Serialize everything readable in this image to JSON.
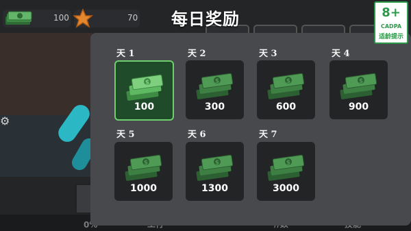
{
  "hud": {
    "cash": "100",
    "stars": "70"
  },
  "title": "每日奖励",
  "rating": {
    "age": "8+",
    "org": "CADPA",
    "label": "适龄提示"
  },
  "bottom_nav": [
    "0%",
    "工行",
    "//数",
    "技能"
  ],
  "days": [
    {
      "label": "天 1",
      "amount": "100",
      "claimed": true
    },
    {
      "label": "天 2",
      "amount": "300",
      "claimed": false
    },
    {
      "label": "天 3",
      "amount": "600",
      "claimed": false
    },
    {
      "label": "天 4",
      "amount": "900",
      "claimed": false
    },
    {
      "label": "天 5",
      "amount": "1000",
      "claimed": false
    },
    {
      "label": "天 6",
      "amount": "1300",
      "claimed": false
    },
    {
      "label": "天 7",
      "amount": "3000",
      "claimed": false
    }
  ],
  "colors": {
    "claimed_border": "#6fcf6f",
    "claimed_bg": "#1f4b2a",
    "card_bg": "#232426",
    "panel_bg": "#47494c",
    "rating_green": "#2c9a4a"
  }
}
